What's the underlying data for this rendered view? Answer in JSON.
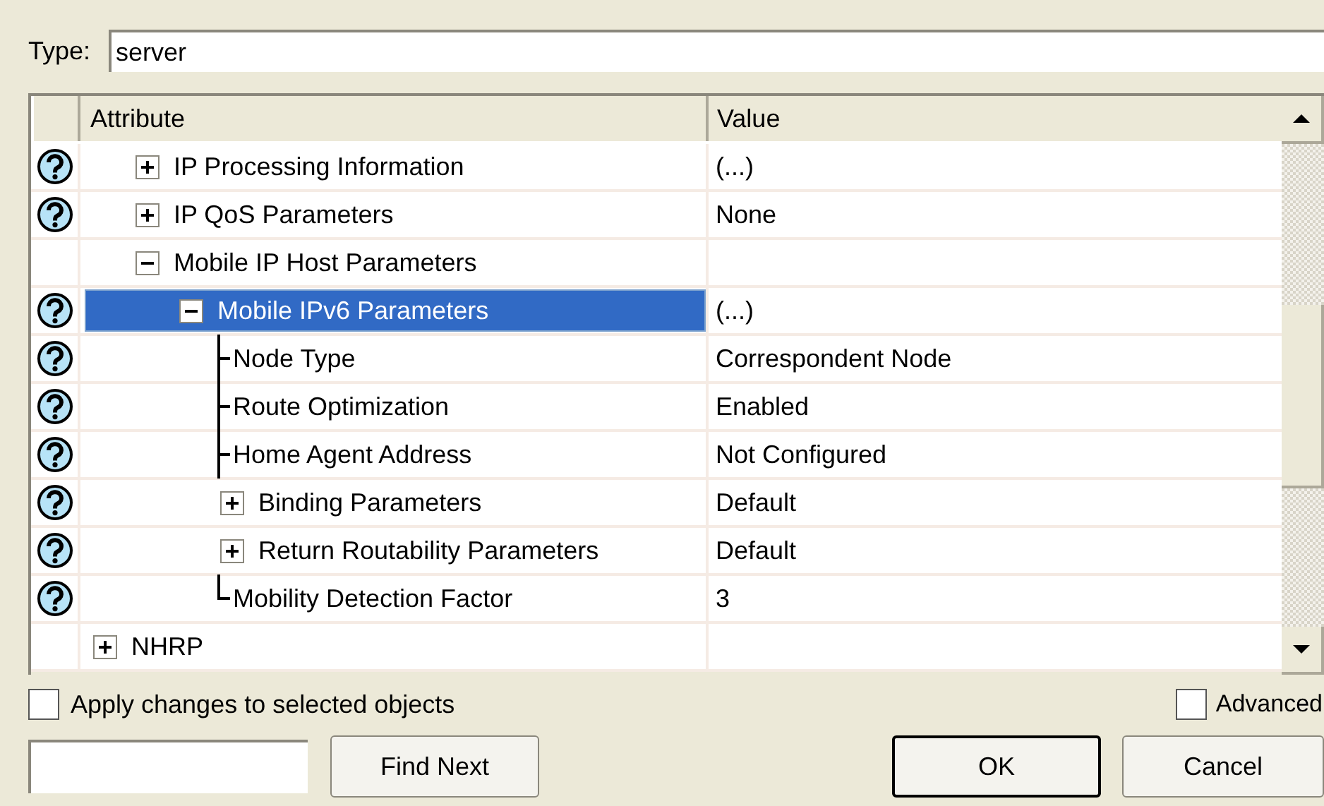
{
  "type_field": {
    "label": "Type:",
    "value": "server"
  },
  "table": {
    "columns": [
      "Attribute",
      "Value"
    ],
    "rows": [
      {
        "children": [
          {
            "label": "IP Processing Information",
            "value": "(...)",
            "help": true,
            "expanded": false,
            "selected": false
          },
          {
            "label": "IP QoS Parameters",
            "value": "None",
            "help": true,
            "expanded": false,
            "selected": false
          },
          {
            "label": "Mobile IP Host Parameters",
            "help": false,
            "expanded": true,
            "selected": false,
            "children": [
              {
                "label": "Mobile IPv6 Parameters",
                "value": "(...)",
                "help": true,
                "expanded": true,
                "selected": true,
                "children": [
                  {
                    "label": "Node Type",
                    "value": "Correspondent Node",
                    "help": true,
                    "selected": false
                  },
                  {
                    "label": "Route Optimization",
                    "value": "Enabled",
                    "help": true,
                    "selected": false
                  },
                  {
                    "label": "Home Agent Address",
                    "value": "Not Configured",
                    "help": true,
                    "selected": false
                  },
                  {
                    "label": "Binding Parameters",
                    "value": "Default",
                    "help": true,
                    "expanded": false,
                    "selected": false
                  },
                  {
                    "label": "Return Routability Parameters",
                    "value": "Default",
                    "help": true,
                    "expanded": false,
                    "selected": false
                  },
                  {
                    "label": "Mobility Detection Factor",
                    "value": "3",
                    "help": true,
                    "selected": false
                  }
                ]
              }
            ]
          }
        ]
      },
      {
        "label": "NHRP",
        "help": false,
        "expanded": false,
        "selected": false
      }
    ]
  },
  "apply_checkbox": {
    "label": "Apply changes to selected objects",
    "checked": false
  },
  "advanced_checkbox": {
    "label": "Advanced",
    "checked": false
  },
  "buttons": [
    {
      "label": "Find Next",
      "default": false
    },
    {
      "label": "OK",
      "default": true
    },
    {
      "label": "Cancel",
      "default": false
    }
  ]
}
